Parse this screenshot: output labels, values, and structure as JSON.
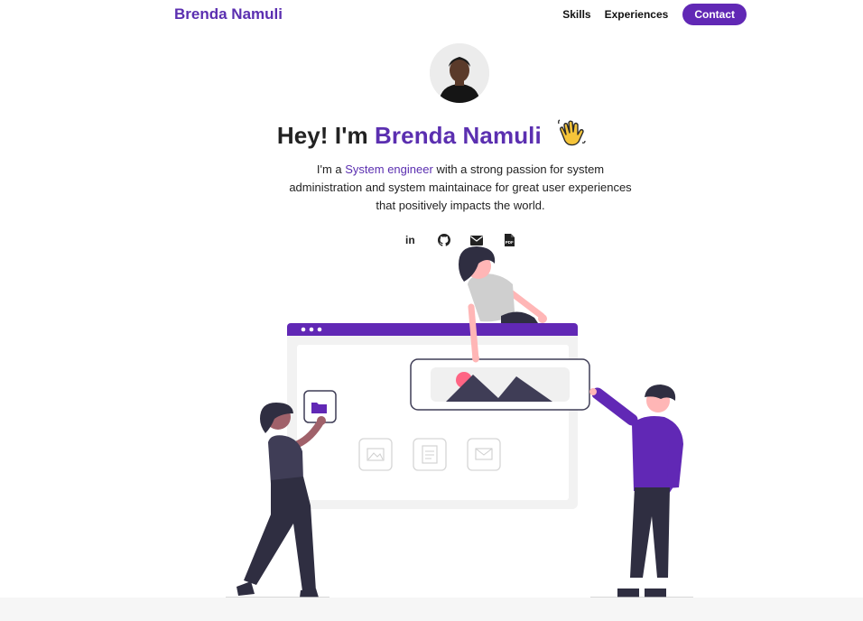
{
  "header": {
    "brand": "Brenda Namuli",
    "nav": {
      "skills": "Skills",
      "experiences": "Experiences",
      "contact": "Contact"
    }
  },
  "hero": {
    "greeting": "Hey! I'm",
    "name": "Brenda Namuli",
    "wave_emoji": "👋",
    "desc_prefix": "I'm a",
    "role": "System engineer",
    "desc_rest": "with a strong passion for system administration and system maintainace for great user experiences that positively impacts the world."
  },
  "socials": [
    {
      "icon": "linkedin-icon",
      "label": "in"
    },
    {
      "icon": "github-icon"
    },
    {
      "icon": "email-icon"
    },
    {
      "icon": "resume-pdf-icon",
      "label": "PDF"
    }
  ],
  "colors": {
    "accent": "#5b2fb0",
    "button": "#6128b5",
    "text": "#222222"
  }
}
